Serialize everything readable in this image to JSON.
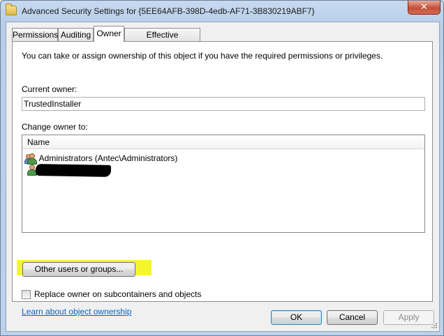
{
  "window": {
    "title": "Advanced Security Settings for {5EE64AFB-398D-4edb-AF71-3B830219ABF7}",
    "close_label": "✕"
  },
  "tabs": [
    {
      "label": "Permissions"
    },
    {
      "label": "Auditing"
    },
    {
      "label": "Owner"
    },
    {
      "label": "Effective Permissions"
    }
  ],
  "owner": {
    "description": "You can take or assign ownership of this object if you have the required permissions or privileges.",
    "current_owner_label": "Current owner:",
    "current_owner_value": "TrustedInstaller",
    "change_owner_label": "Change owner to:",
    "column_name": "Name",
    "rows": [
      {
        "name": "Administrators (Antec\\Administrators)",
        "icon": "group-icon"
      },
      {
        "name": "",
        "icon": "user-icon",
        "redacted": true
      }
    ],
    "other_users_button": "Other users or groups...",
    "replace_checkbox_label": "Replace owner on subcontainers and objects",
    "replace_checked": false,
    "learn_link": "Learn about object ownership"
  },
  "buttons": {
    "ok": "OK",
    "cancel": "Cancel",
    "apply": "Apply"
  },
  "colors": {
    "highlight": "#f5f52e",
    "link": "#0066cc"
  }
}
